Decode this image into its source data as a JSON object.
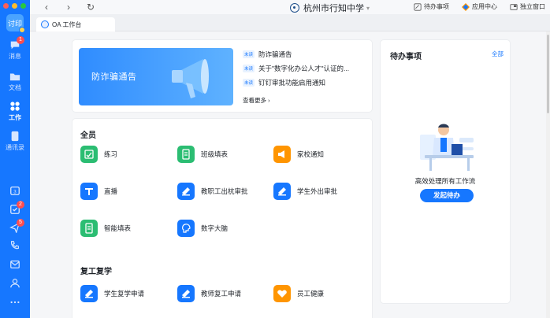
{
  "rail": {
    "avatar_text": "讨印",
    "items": [
      {
        "label": "消息",
        "badge": "1"
      },
      {
        "label": "文档"
      },
      {
        "label": "工作"
      },
      {
        "label": "通讯录"
      }
    ],
    "bottom_badges": [
      "2",
      "5"
    ]
  },
  "topbar": {
    "org_name": "杭州市行知中学",
    "actions": [
      "待办事项",
      "应用中心",
      "独立窗口"
    ]
  },
  "tab": {
    "label": "OA 工作台"
  },
  "notices": {
    "banner_text": "防诈骗通告",
    "tag": "未读",
    "items": [
      "防诈骗通告",
      "关于\"数字化办公人才\"认证的...",
      "钉钉审批功能启用通知"
    ],
    "more": "查看更多"
  },
  "sections": [
    {
      "title": "全员",
      "apps": [
        "练习",
        "班级填表",
        "家校通知",
        "直播",
        "教职工出杭审批",
        "学生外出审批",
        "智能填表",
        "数字大脑"
      ]
    },
    {
      "title": "复工复学",
      "apps": [
        "学生复学申请",
        "教师复工申请",
        "员工健康"
      ]
    }
  ],
  "todo": {
    "title": "待办事项",
    "all": "全部",
    "desc": "高效处理所有工作流",
    "button": "发起待办"
  },
  "colors": {
    "brand": "#1677ff",
    "green": "#2bbd72",
    "orange": "#ff9500"
  }
}
